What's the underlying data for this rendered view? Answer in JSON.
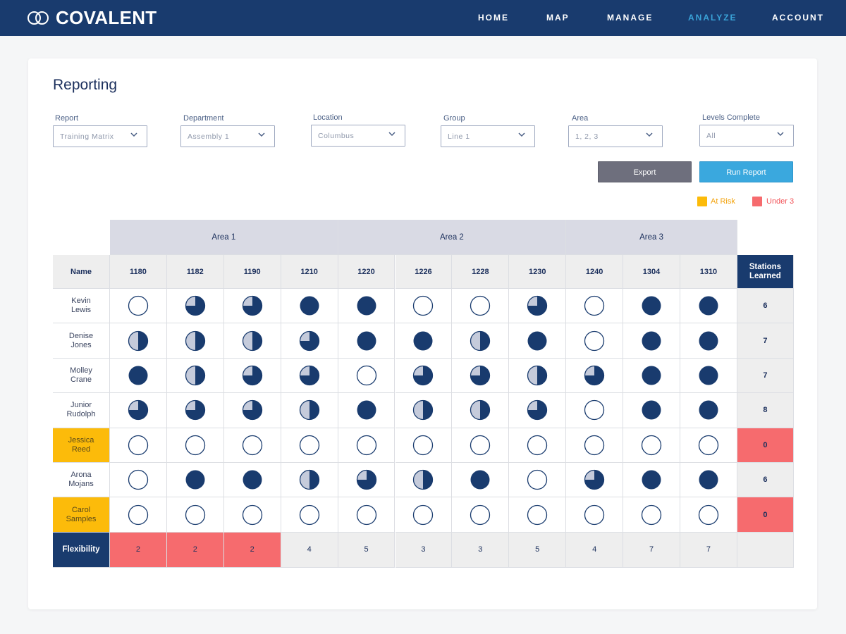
{
  "app": {
    "logo_text": "COVALENT"
  },
  "nav": [
    {
      "label": "HOME",
      "active": false
    },
    {
      "label": "MAP",
      "active": false
    },
    {
      "label": "MANAGE",
      "active": false
    },
    {
      "label": "ANALYZE",
      "active": true
    },
    {
      "label": "ACCOUNT",
      "active": false
    }
  ],
  "page": {
    "title": "Reporting"
  },
  "filters": [
    {
      "label": "Report",
      "value": "Training Matrix"
    },
    {
      "label": "Department",
      "value": "Assembly 1"
    },
    {
      "label": "Location",
      "value": "Columbus"
    },
    {
      "label": "Group",
      "value": "Line 1"
    },
    {
      "label": "Area",
      "value": "1, 2, 3"
    },
    {
      "label": "Levels Complete",
      "value": "All"
    }
  ],
  "buttons": {
    "export": "Export",
    "run": "Run Report"
  },
  "legend": [
    {
      "label": "At Risk",
      "color": "#fcbb0a"
    },
    {
      "label": "Under 3",
      "color": "#f66b6e"
    }
  ],
  "colors": {
    "navy": "#193b6e",
    "accent": "#3aa3d8",
    "light_fill": "#c5cbdb",
    "at_risk": "#fcbb0a",
    "under": "#f66b6e"
  },
  "matrix": {
    "areas": [
      {
        "label": "Area 1",
        "span": 4
      },
      {
        "label": "Area 2",
        "span": 4
      },
      {
        "label": "Area 3",
        "span": 3
      }
    ],
    "name_header": "Name",
    "stations": [
      "1180",
      "1182",
      "1190",
      "1210",
      "1220",
      "1226",
      "1228",
      "1230",
      "1240",
      "1304",
      "1310"
    ],
    "stations_learned_header": "Stations Learned",
    "level_scale": "quarters (0 = empty circle, 4 = full circle)",
    "rows": [
      {
        "name": "Kevin Lewis",
        "at_risk": false,
        "levels": [
          0,
          3,
          3,
          4,
          4,
          0,
          0,
          3,
          0,
          4,
          4
        ],
        "stations_learned": "6",
        "under": false
      },
      {
        "name": "Denise Jones",
        "at_risk": false,
        "levels": [
          2,
          2,
          2,
          3,
          4,
          4,
          2,
          4,
          0,
          4,
          4
        ],
        "stations_learned": "7",
        "under": false
      },
      {
        "name": "Molley Crane",
        "at_risk": false,
        "levels": [
          4,
          2,
          3,
          3,
          0,
          3,
          3,
          2,
          3,
          4,
          4
        ],
        "stations_learned": "7",
        "under": false
      },
      {
        "name": "Junior Rudolph",
        "at_risk": false,
        "levels": [
          3,
          3,
          3,
          2,
          4,
          2,
          2,
          3,
          0,
          4,
          4
        ],
        "stations_learned": "8",
        "under": false
      },
      {
        "name": "Jessica Reed",
        "at_risk": true,
        "levels": [
          0,
          0,
          0,
          0,
          0,
          0,
          0,
          0,
          0,
          0,
          0
        ],
        "stations_learned": "0",
        "under": true
      },
      {
        "name": "Arona Mojans",
        "at_risk": false,
        "levels": [
          0,
          4,
          4,
          2,
          3,
          2,
          4,
          0,
          3,
          4,
          4
        ],
        "stations_learned": "6",
        "under": false
      },
      {
        "name": "Carol Samples",
        "at_risk": true,
        "levels": [
          0,
          0,
          0,
          0,
          0,
          0,
          0,
          0,
          0,
          0,
          0
        ],
        "stations_learned": "0",
        "under": true
      }
    ],
    "flexibility_label": "Flexibility",
    "flexibility": [
      {
        "value": "2",
        "under": true
      },
      {
        "value": "2",
        "under": true
      },
      {
        "value": "2",
        "under": true
      },
      {
        "value": "4",
        "under": false
      },
      {
        "value": "5",
        "under": false
      },
      {
        "value": "3",
        "under": false
      },
      {
        "value": "3",
        "under": false
      },
      {
        "value": "5",
        "under": false
      },
      {
        "value": "4",
        "under": false
      },
      {
        "value": "7",
        "under": false
      },
      {
        "value": "7",
        "under": false
      }
    ]
  }
}
